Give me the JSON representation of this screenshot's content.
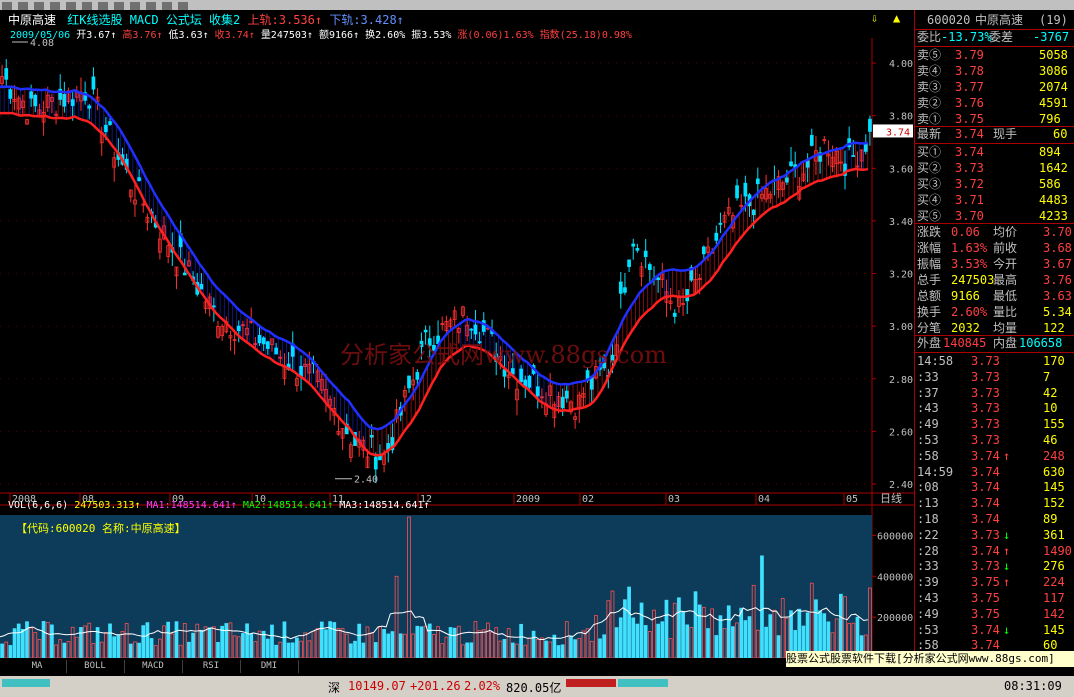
{
  "header": {
    "stock_name": "中原高速",
    "menu": "红K线选股 MACD 公式坛 收集2",
    "upper_label": "上轨:3.536↑",
    "lower_label": "下轨:3.428↑",
    "date": "2009/05/06",
    "open": "开3.67↑",
    "high": "高3.76↑",
    "low": "低3.63↑",
    "close": "收3.74↑",
    "volume": "量247503↑",
    "amount": "额9166↑",
    "turnover": "换2.60%",
    "amplitude": "振3.53%",
    "change": "涨(0.06)1.63%",
    "index": "指数(25.18)0.98%"
  },
  "price_axis": [
    "4.00",
    "3.80",
    "3.60",
    "3.40",
    "3.20",
    "3.00",
    "2.80",
    "2.60",
    "2.40"
  ],
  "hi_label": "4.08",
  "lo_label": "2.40",
  "current_tag": "3.74",
  "time_axis": [
    "2008",
    "08",
    "09",
    "10",
    "11",
    "12",
    "2009",
    "02",
    "03",
    "04",
    "05"
  ],
  "period_label": "日线",
  "vol_header": {
    "label": "VOL(6,6,6)",
    "value": "247503.313↑",
    "ma1": "MA1:148514.641↑",
    "ma2": "MA2:148514.641↑",
    "ma3": "MA3:148514.641↑"
  },
  "vol_code": "【代码:600020 名称:中原高速】",
  "vol_axis": [
    "600000",
    "400000",
    "200000"
  ],
  "watermark": "分析家公式网www.88gs.com",
  "tabs": [
    "MA",
    "BOLL",
    "MACD",
    "RSI",
    "DMI"
  ],
  "ad_text": "股票公式股票软件下载[分析家公式网www.88gs.com]",
  "status": {
    "market": "深",
    "value": "10149.07",
    "chg": "+201.26",
    "pct": "2.02%",
    "amt": "820.05亿",
    "time": "08:31:09"
  },
  "quote": {
    "code": "600020",
    "name": "中原高速",
    "count": "(19)",
    "weibi_label": "委比",
    "weibi": "-13.73%",
    "weicha_label": "委差",
    "weicha": "-3767",
    "asks": [
      {
        "l": "卖⑤",
        "p": "3.79",
        "v": "5058"
      },
      {
        "l": "卖④",
        "p": "3.78",
        "v": "3086"
      },
      {
        "l": "卖③",
        "p": "3.77",
        "v": "2074"
      },
      {
        "l": "卖②",
        "p": "3.76",
        "v": "4591"
      },
      {
        "l": "卖①",
        "p": "3.75",
        "v": "796"
      }
    ],
    "last_label": "最新",
    "last": "3.74",
    "hand_label": "现手",
    "hand": "60",
    "bids": [
      {
        "l": "买①",
        "p": "3.74",
        "v": "894"
      },
      {
        "l": "买②",
        "p": "3.73",
        "v": "1642"
      },
      {
        "l": "买③",
        "p": "3.72",
        "v": "586"
      },
      {
        "l": "买④",
        "p": "3.71",
        "v": "4483"
      },
      {
        "l": "买⑤",
        "p": "3.70",
        "v": "4233"
      }
    ],
    "stats": [
      {
        "a": "涨跌",
        "b": "0.06",
        "c": "均价",
        "d": "3.70"
      },
      {
        "a": "涨幅",
        "b": "1.63%",
        "c": "前收",
        "d": "3.68"
      },
      {
        "a": "振幅",
        "b": "3.53%",
        "c": "今开",
        "d": "3.67"
      },
      {
        "a": "总手",
        "b": "247503",
        "c": "最高",
        "d": "3.76"
      },
      {
        "a": "总额",
        "b": "9166",
        "c": "最低",
        "d": "3.63"
      },
      {
        "a": "换手",
        "b": "2.60%",
        "c": "量比",
        "d": "5.34"
      },
      {
        "a": "分笔",
        "b": "2032",
        "c": "均量",
        "d": "122"
      }
    ],
    "outer_label": "外盘",
    "outer": "140845",
    "inner_label": "内盘",
    "inner": "106658",
    "ticks": [
      {
        "t": "14:58",
        "p": "3.73",
        "v": "170",
        "a": "",
        "up": false
      },
      {
        "t": ":33",
        "p": "3.73",
        "v": "7",
        "a": "",
        "up": false
      },
      {
        "t": ":37",
        "p": "3.73",
        "v": "42",
        "a": "",
        "up": false
      },
      {
        "t": ":43",
        "p": "3.73",
        "v": "10",
        "a": "",
        "up": false
      },
      {
        "t": ":49",
        "p": "3.73",
        "v": "155",
        "a": "",
        "up": false
      },
      {
        "t": ":53",
        "p": "3.73",
        "v": "46",
        "a": "",
        "up": false
      },
      {
        "t": ":58",
        "p": "3.74",
        "v": "248",
        "a": "↑",
        "up": true
      },
      {
        "t": "14:59",
        "p": "3.74",
        "v": "630",
        "a": "",
        "up": false
      },
      {
        "t": ":08",
        "p": "3.74",
        "v": "145",
        "a": "",
        "up": false
      },
      {
        "t": ":13",
        "p": "3.74",
        "v": "152",
        "a": "",
        "up": false
      },
      {
        "t": ":18",
        "p": "3.74",
        "v": "89",
        "a": "",
        "up": false
      },
      {
        "t": ":22",
        "p": "3.73",
        "v": "361",
        "a": "↓",
        "up": false
      },
      {
        "t": ":28",
        "p": "3.74",
        "v": "1490",
        "a": "↑",
        "up": true
      },
      {
        "t": ":33",
        "p": "3.73",
        "v": "276",
        "a": "↓",
        "up": false
      },
      {
        "t": ":39",
        "p": "3.75",
        "v": "224",
        "a": "↑",
        "up": true
      },
      {
        "t": ":43",
        "p": "3.75",
        "v": "117",
        "a": "",
        "up": true
      },
      {
        "t": ":49",
        "p": "3.75",
        "v": "142",
        "a": "",
        "up": true
      },
      {
        "t": ":53",
        "p": "3.74",
        "v": "145",
        "a": "↓",
        "up": false
      },
      {
        "t": ":58",
        "p": "3.74",
        "v": "60",
        "a": "",
        "up": false
      }
    ]
  },
  "colors": {
    "up": "#ff3030",
    "down": "#00e0ff",
    "band_up": "#ff2020",
    "band_dn": "#2030ff",
    "vol_bg": "#0a4a6a"
  }
}
